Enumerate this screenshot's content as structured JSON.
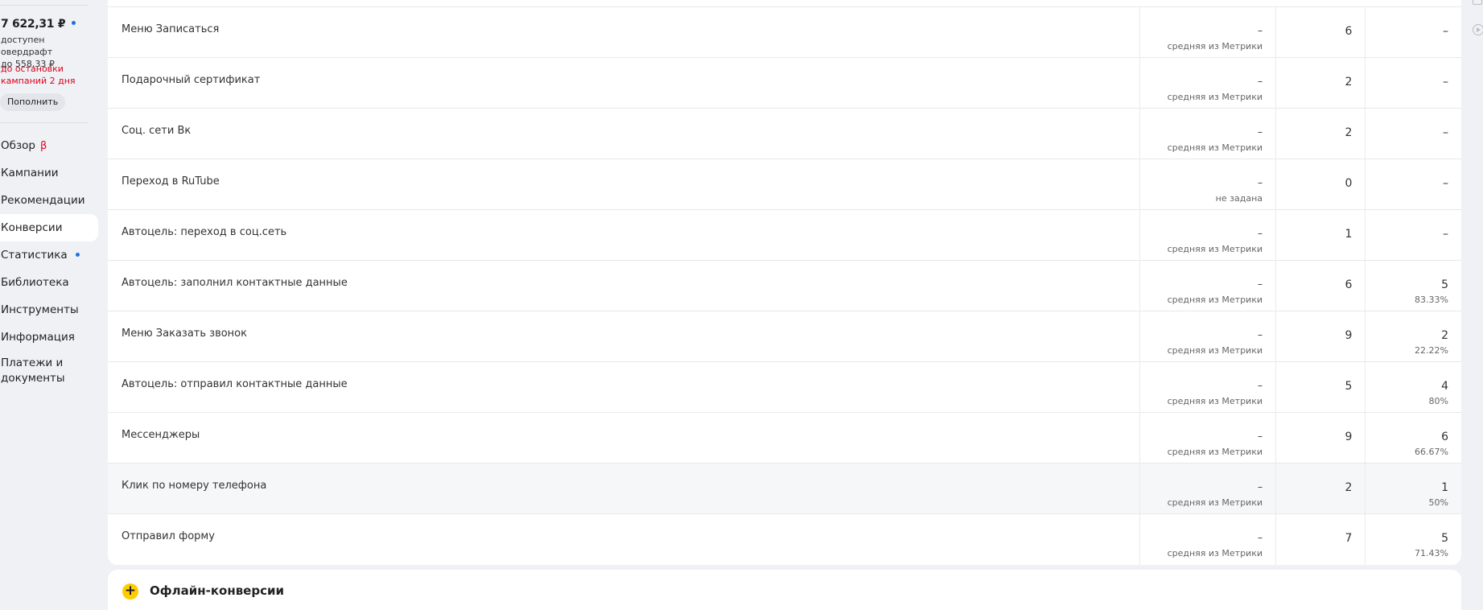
{
  "sidebar": {
    "balance": "7 622,31 ₽",
    "overdraft_line1": "доступен овердрафт",
    "overdraft_line2": "до 558,33 ₽",
    "warning_line1": "до остановки",
    "warning_line2": "кампаний 2 дня",
    "topup_label": "Пополнить",
    "nav": [
      {
        "label": "Обзор",
        "badge": "β"
      },
      {
        "label": "Кампании"
      },
      {
        "label": "Рекомендации"
      },
      {
        "label": "Конверсии",
        "active": true
      },
      {
        "label": "Статистика",
        "dot": true
      },
      {
        "label": "Библиотека"
      },
      {
        "label": "Инструменты"
      },
      {
        "label": "Информация"
      },
      {
        "label": "Платежи и",
        "label2": "документы"
      }
    ]
  },
  "rows": [
    {
      "name": "Меню Записаться",
      "value": "–",
      "source": "средняя из Метрики",
      "count": "6",
      "conv": "–",
      "pct": ""
    },
    {
      "name": "Подарочный сертификат",
      "value": "–",
      "source": "средняя из Метрики",
      "count": "2",
      "conv": "–",
      "pct": ""
    },
    {
      "name": "Соц. сети Вк",
      "value": "–",
      "source": "средняя из Метрики",
      "count": "2",
      "conv": "–",
      "pct": ""
    },
    {
      "name": "Переход в RuTube",
      "value": "–",
      "source": "не задана",
      "count": "0",
      "conv": "–",
      "pct": ""
    },
    {
      "name": "Автоцель: переход в соц.сеть",
      "value": "–",
      "source": "средняя из Метрики",
      "count": "1",
      "conv": "–",
      "pct": ""
    },
    {
      "name": "Автоцель: заполнил контактные данные",
      "value": "–",
      "source": "средняя из Метрики",
      "count": "6",
      "conv": "5",
      "pct": "83.33%"
    },
    {
      "name": "Меню Заказать звонок",
      "value": "–",
      "source": "средняя из Метрики",
      "count": "9",
      "conv": "2",
      "pct": "22.22%"
    },
    {
      "name": "Автоцель: отправил контактные данные",
      "value": "–",
      "source": "средняя из Метрики",
      "count": "5",
      "conv": "4",
      "pct": "80%"
    },
    {
      "name": "Мессенджеры",
      "value": "–",
      "source": "средняя из Метрики",
      "count": "9",
      "conv": "6",
      "pct": "66.67%"
    },
    {
      "name": "Клик по номеру телефона",
      "value": "–",
      "source": "средняя из Метрики",
      "count": "2",
      "conv": "1",
      "pct": "50%",
      "highlighted": true
    },
    {
      "name": "Отправил форму",
      "value": "–",
      "source": "средняя из Метрики",
      "count": "7",
      "conv": "5",
      "pct": "71.43%"
    }
  ],
  "offline": {
    "plus_icon": "+",
    "title": "Офлайн-конверсии"
  },
  "icons": [
    "panel-icon",
    "play-circle-icon",
    "plus-icon"
  ],
  "colors": {
    "accent_yellow": "#ffcc00",
    "warning_red": "#e0001b",
    "dot_blue": "#1f6feb"
  }
}
